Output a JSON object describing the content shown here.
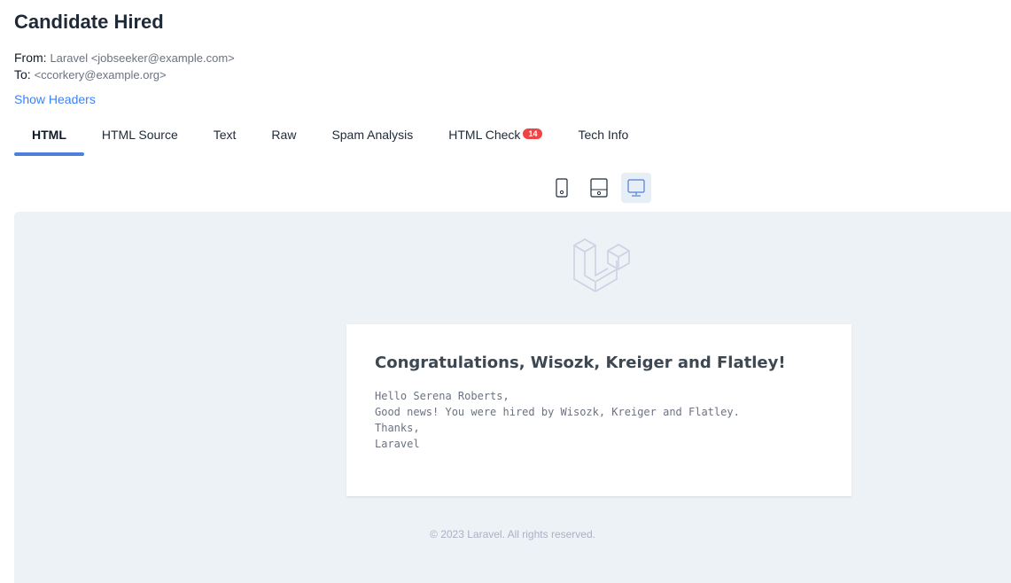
{
  "email": {
    "subject": "Candidate Hired",
    "from_label": "From:",
    "from_value": "Laravel <jobseeker@example.com>",
    "to_label": "To:",
    "to_value": "<ccorkery@example.org>",
    "show_headers": "Show Headers"
  },
  "tabs": [
    {
      "label": "HTML",
      "active": true
    },
    {
      "label": "HTML Source"
    },
    {
      "label": "Text"
    },
    {
      "label": "Raw"
    },
    {
      "label": "Spam Analysis"
    },
    {
      "label": "HTML Check",
      "badge": "14"
    },
    {
      "label": "Tech Info"
    }
  ],
  "device_toggles": [
    {
      "icon": "phone-icon"
    },
    {
      "icon": "tablet-icon"
    },
    {
      "icon": "desktop-icon",
      "active": true
    }
  ],
  "preview": {
    "logo": "laravel-logo-icon",
    "heading": "Congratulations, Wisozk, Kreiger and Flatley!",
    "lines": [
      "Hello Serena Roberts,",
      "Good news! You were hired by Wisozk, Kreiger and Flatley.",
      "Thanks,",
      "Laravel"
    ],
    "footer": "© 2023 Laravel. All rights reserved."
  },
  "colors": {
    "accent": "#4f7fd9",
    "link": "#3b82f6",
    "badge": "#ef4444",
    "preview_bg": "#edf2f7"
  }
}
